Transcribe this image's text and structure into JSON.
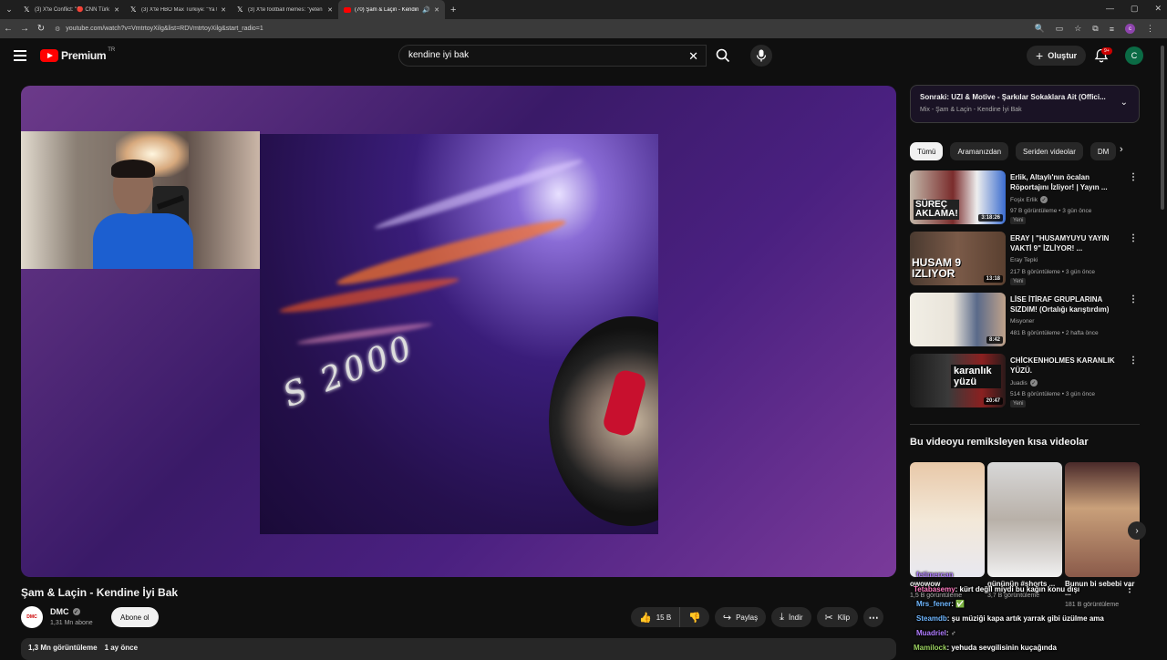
{
  "browser": {
    "tabs": [
      {
        "title": "(3) X'te Conflict: \"🔴 CNN Türk",
        "icon": "x-logo-icon",
        "active": false
      },
      {
        "title": "(3) X'te HBO Max Türkiye: \"Ya t",
        "icon": "x-logo-icon",
        "active": false
      },
      {
        "title": "(3) X'te football memes: \"yeten",
        "icon": "x-logo-icon",
        "active": false
      },
      {
        "title": "(70) Şam & Laçin - Kendine",
        "icon": "youtube-icon",
        "active": true
      }
    ],
    "new_tab": "+",
    "url": "youtube.com/watch?v=VmtrtoyXilg&list=RDVmtrtoyXilg&start_radio=1",
    "profile_initial": "c"
  },
  "header": {
    "logo": "Premium",
    "region": "TR",
    "search_value": "kendine iyi bak",
    "create_label": "Oluştur",
    "notif_badge": "9+",
    "avatar_initial": "C"
  },
  "video": {
    "title": "Şam & Laçin - Kendine İyi Bak",
    "channel": "DMC",
    "channel_avatar": "DMC",
    "subscribers": "1,31 Mn abone",
    "subscribe_label": "Abone ol",
    "likes": "15 B",
    "share_label": "Paylaş",
    "download_label": "İndir",
    "clip_label": "Klip",
    "views": "1,3 Mn görüntüleme",
    "age": "1 ay önce",
    "emblem": "S 2000"
  },
  "playlist": {
    "next": "Sonraki: UZI & Motive - Şarkılar Sokaklara Ait (Offici...",
    "mix": "Mix - Şam & Laçin - Kendine İyi Bak"
  },
  "chips": [
    "Tümü",
    "Aramanızdan",
    "Seriden videolar",
    "DM"
  ],
  "recommendations": [
    {
      "title": "Erlik, Altaylı'nın öcalan Röportajını İzliyor! | Yayın ...",
      "channel": "Foşix Erlik",
      "meta": "97 B görüntüleme • 3 gün önce",
      "badge": "Yeni",
      "duration": "3:18:26",
      "thumb_text": "SÜREÇ AKLAMA!"
    },
    {
      "title": "ERAY | \"HUSAMYUYU YAYIN VAKTİ 9\" İZLİYOR! ...",
      "channel": "Eray Tepki",
      "meta": "217 B görüntüleme • 3 gün önce",
      "badge": "Yeni",
      "duration": "13:18",
      "thumb_text": "HUSAM 9 IZLIYOR"
    },
    {
      "title": "LİSE İTİRAF GRUPLARINA SIZDIM! (Ortalığı karıştırdım)",
      "channel": "Misyoner",
      "meta": "481 B görüntüleme • 2 hafta önce",
      "badge": "",
      "duration": "8:42",
      "thumb_text": ""
    },
    {
      "title": "CHİCKENHOLMES KARANLIK YÜZÜ.",
      "channel": "Juadis",
      "meta": "514 B görüntüleme • 3 gün önce",
      "badge": "Yeni",
      "duration": "20:47",
      "thumb_text": "karanlık yüzü"
    }
  ],
  "shorts": {
    "heading": "Bu videoyu remiksleyen kısa videolar",
    "items": [
      {
        "title": "owowow",
        "views": "1,5 B görüntüleme"
      },
      {
        "title": "gününün #shorts ...",
        "views": "3,7 B görüntüleme"
      },
      {
        "title": "Bunun bi sebebi var ...",
        "views": "181 B görüntüleme"
      }
    ]
  },
  "chat": [
    {
      "user": "fetimercan",
      "msg": ""
    },
    {
      "user": "Tetabasemy",
      "msg": ": kürt değil miydi bu kağın konu dışı"
    },
    {
      "user": "Mrs_fener",
      "msg": ": ✅"
    },
    {
      "user": "Steamdb",
      "msg": ": şu müziği kapa artık yarrak gibi üzülme ama"
    },
    {
      "user": "Muadriel",
      "msg": ": ♂"
    },
    {
      "user": "Mamilock",
      "msg": ": yehuda sevgilisinin kuçağında"
    }
  ]
}
